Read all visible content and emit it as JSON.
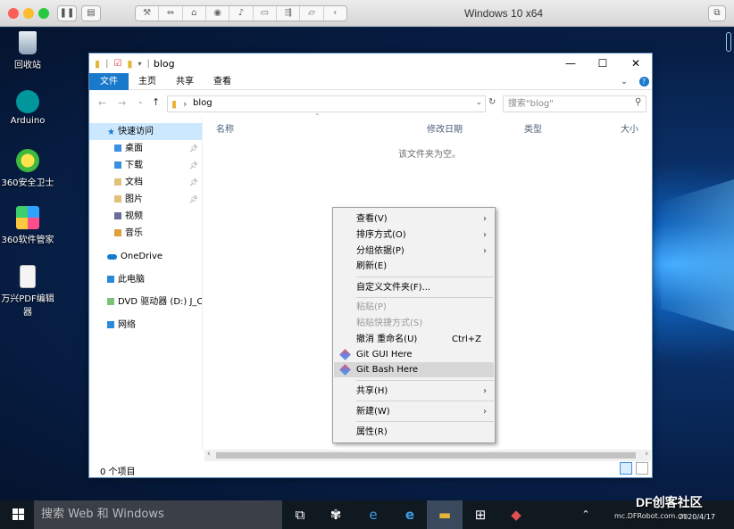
{
  "mac": {
    "title": "Windows 10 x64"
  },
  "desktop": {
    "icons": [
      {
        "label": "回收站",
        "icon": "recycle-bin-icon"
      },
      {
        "label": "Arduino",
        "icon": "arduino-icon"
      },
      {
        "label": "360安全卫士",
        "icon": "shield-icon"
      },
      {
        "label": "360软件管家",
        "icon": "app-store-icon"
      },
      {
        "label": "万兴PDF编辑器",
        "icon": "pdf-icon"
      }
    ]
  },
  "explorer": {
    "title": "blog",
    "tabs": [
      "文件",
      "主页",
      "共享",
      "查看"
    ],
    "address": "blog",
    "search_placeholder": "搜索\"blog\"",
    "nav": [
      {
        "label": "快速访问",
        "pinned": false
      },
      {
        "label": "桌面",
        "pinned": true
      },
      {
        "label": "下载",
        "pinned": true
      },
      {
        "label": "文档",
        "pinned": true
      },
      {
        "label": "图片",
        "pinned": true
      },
      {
        "label": "视频",
        "pinned": false
      },
      {
        "label": "音乐",
        "pinned": false
      },
      {
        "label": "OneDrive",
        "pinned": false
      },
      {
        "label": "此电脑",
        "pinned": false
      },
      {
        "label": "DVD 驱动器 (D:) J_CC",
        "pinned": false
      },
      {
        "label": "网络",
        "pinned": false
      }
    ],
    "columns": [
      "名称",
      "修改日期",
      "类型",
      "大小"
    ],
    "empty_text": "该文件夹为空。",
    "status": "0 个项目"
  },
  "context_menu": {
    "items": [
      {
        "label": "查看(V)",
        "submenu": true
      },
      {
        "label": "排序方式(O)",
        "submenu": true
      },
      {
        "label": "分组依据(P)",
        "submenu": true
      },
      {
        "label": "刷新(E)"
      },
      {
        "label": "自定义文件夹(F)..."
      },
      {
        "label": "粘贴(P)",
        "disabled": true
      },
      {
        "label": "粘贴快捷方式(S)",
        "disabled": true
      },
      {
        "label": "撤消 重命名(U)",
        "shortcut": "Ctrl+Z"
      },
      {
        "label": "Git GUI Here"
      },
      {
        "label": "Git Bash Here",
        "highlighted": true
      },
      {
        "label": "共享(H)",
        "submenu": true
      },
      {
        "label": "新建(W)",
        "submenu": true
      },
      {
        "label": "属性(R)"
      }
    ]
  },
  "taskbar": {
    "search_placeholder": "搜索 Web 和 Windows",
    "time": "2020/4/17"
  },
  "watermark": {
    "brand": "DF创客社区",
    "url": "mc.DFRobot.com.cn"
  }
}
